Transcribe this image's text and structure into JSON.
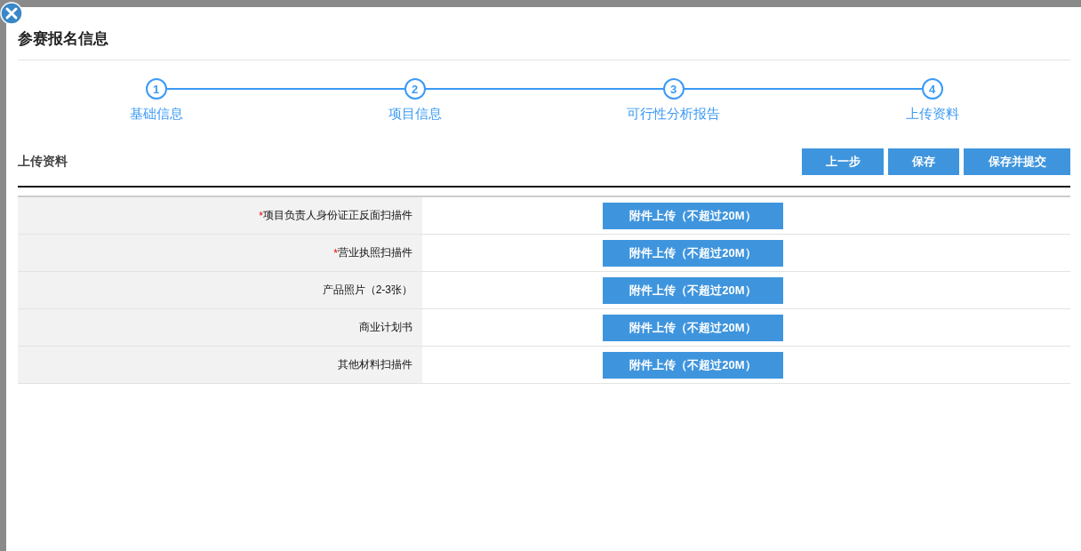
{
  "dialog": {
    "title": "参赛报名信息"
  },
  "steps": [
    {
      "number": "1",
      "label": "基础信息"
    },
    {
      "number": "2",
      "label": "项目信息"
    },
    {
      "number": "3",
      "label": "可行性分析报告"
    },
    {
      "number": "4",
      "label": "上传资料"
    }
  ],
  "section": {
    "title": "上传资料",
    "buttons": [
      "上一步",
      "保存",
      "保存并提交"
    ]
  },
  "rows": [
    {
      "mark": "*",
      "label": "项目负责人身份证正反面扫描件",
      "button": "附件上传（不超过20M）"
    },
    {
      "mark": "*",
      "label": "营业执照扫描件",
      "button": "附件上传（不超过20M）"
    },
    {
      "label": "产品照片（2-3张）",
      "button": "附件上传（不超过20M）"
    },
    {
      "label": "商业计划书",
      "button": "附件上传（不超过20M）"
    },
    {
      "label": "其他材料扫描件",
      "button": "附件上传（不超过20M）"
    }
  ]
}
